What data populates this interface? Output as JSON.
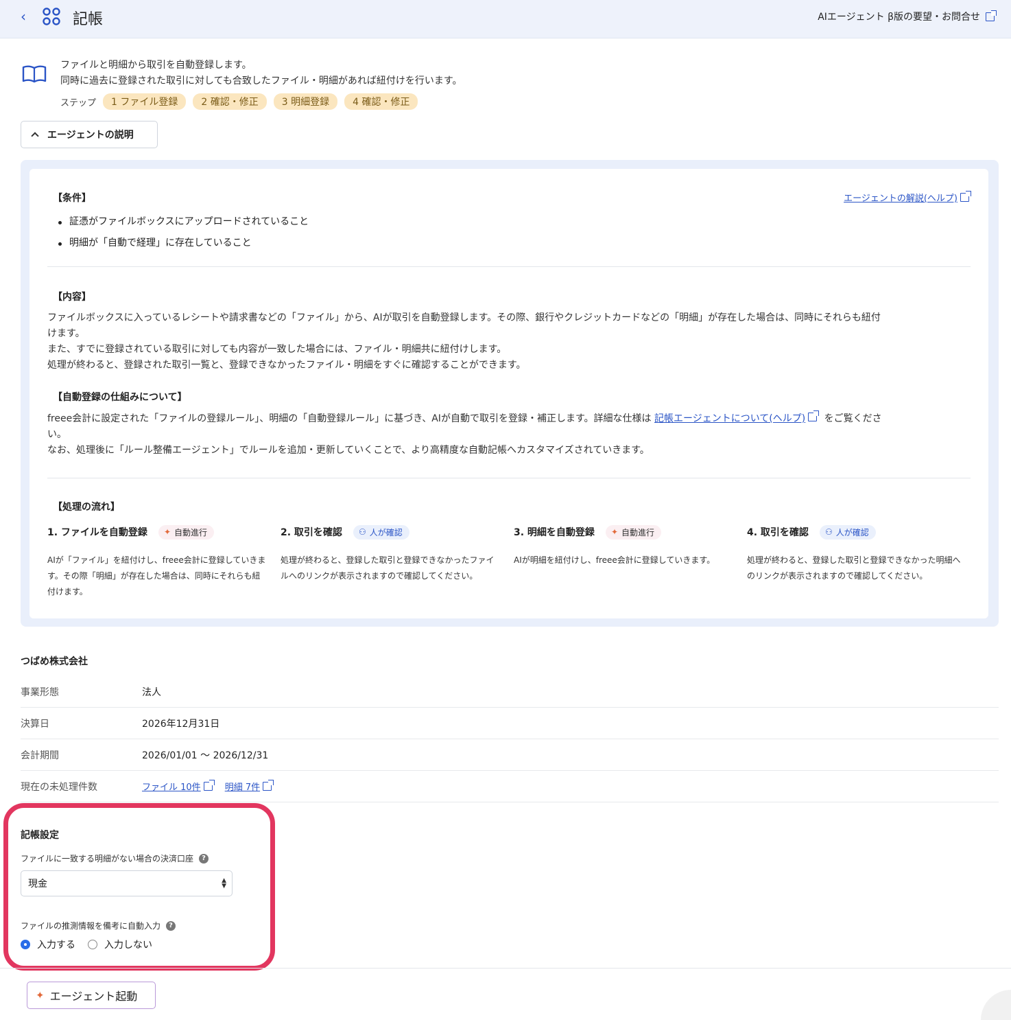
{
  "header": {
    "back_label": "‹",
    "title": "記帳",
    "feedback_label": "AIエージェント β版の要望・お問合せ"
  },
  "intro": {
    "line1": "ファイルと明細から取引を自動登録します。",
    "line2": "同時に過去に登録された取引に対しても合致したファイル・明細があれば紐付けを行います。",
    "steps_label": "ステップ",
    "steps": [
      "1 ファイル登録",
      "2 確認・修正",
      "3 明細登録",
      "4 確認・修正"
    ]
  },
  "toggle": {
    "label": "エージェントの説明"
  },
  "description": {
    "conditions_title": "【条件】",
    "help_link": "エージェントの解説(ヘルプ)",
    "conditions": [
      "証憑がファイルボックスにアップロードされていること",
      "明細が「自動で経理」に存在していること"
    ],
    "content_title": "【内容】",
    "content_lines": [
      "ファイルボックスに入っているレシートや請求書などの「ファイル」から、AIが取引を自動登録します。その際、銀行やクレジットカードなどの「明細」が存在した場合は、同時にそれらも紐付",
      "けます。",
      "また、すでに登録されている取引に対しても内容が一致した場合には、ファイル・明細共に紐付けします。",
      "処理が終わると、登録された取引一覧と、登録できなかったファイル・明細をすぐに確認することができます。"
    ],
    "mechanism_title": "【自動登録の仕組みについて】",
    "mechanism_pre": "freee会計に設定された「ファイルの登録ルール」、明細の「自動登録ルール」に基づき、AIが自動で取引を登録・補正します。詳細な仕様は ",
    "mechanism_link": "記帳エージェントについて(ヘルプ)",
    "mechanism_post": " をご覧くださ",
    "mechanism_line2": "い。",
    "mechanism_line3": "なお、処理後に「ルール整備エージェント」でルールを追加・更新していくことで、より高精度な自動記帳へカスタマイズされていきます。",
    "flow_title": "【処理の流れ】",
    "flow": [
      {
        "title": "1. ファイルを自動登録",
        "badge": "自動進行",
        "kind": "auto",
        "text": "AIが「ファイル」を紐付けし、freee会計に登録していきます。その際「明細」が存在した場合は、同時にそれらも紐付けます。"
      },
      {
        "title": "2. 取引を確認",
        "badge": "人が確認",
        "kind": "human",
        "text": "処理が終わると、登録した取引と登録できなかったファイルへのリンクが表示されますので確認してください。"
      },
      {
        "title": "3. 明細を自動登録",
        "badge": "自動進行",
        "kind": "auto",
        "text": "AIが明細を紐付けし、freee会計に登録していきます。"
      },
      {
        "title": "4. 取引を確認",
        "badge": "人が確認",
        "kind": "human",
        "text": "処理が終わると、登録した取引と登録できなかった明細へのリンクが表示されますので確認してください。"
      }
    ]
  },
  "company": {
    "name": "つばめ株式会社",
    "rows": [
      {
        "label": "事業形態",
        "value": "法人"
      },
      {
        "label": "決算日",
        "value": "2026年12月31日"
      },
      {
        "label": "会計期間",
        "value": "2026/01/01 〜 2026/12/31"
      }
    ],
    "pending_label": "現在の未処理件数",
    "pending_files": "ファイル 10件",
    "pending_statements": "明細 7件"
  },
  "settings": {
    "title": "記帳設定",
    "account_label": "ファイルに一致する明細がない場合の決済口座",
    "account_value": "現金",
    "memo_label": "ファイルの推測情報を備考に自動入力",
    "radio_yes": "入力する",
    "radio_no": "入力しない",
    "selected": "yes",
    "highlight_color": "#e2365f"
  },
  "start_button": {
    "label": "エージェント起動"
  },
  "colors": {
    "accent": "#2a54c6",
    "step_chip": "#fbe6bf",
    "header_bg": "#eef2fb"
  }
}
